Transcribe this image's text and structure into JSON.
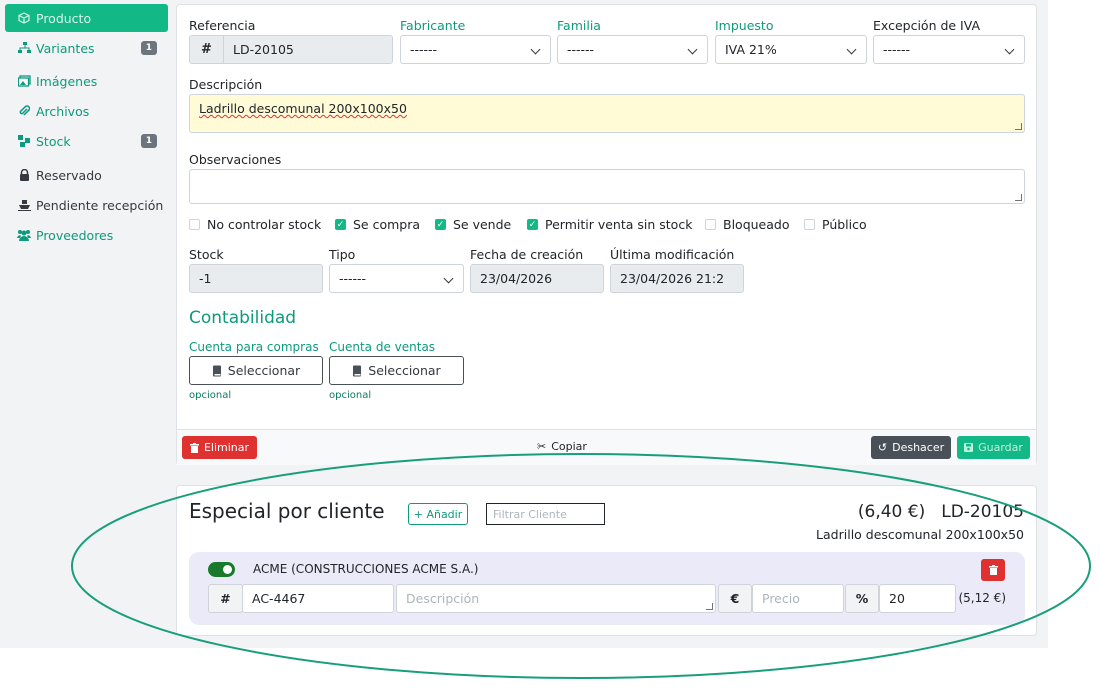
{
  "sidebar": {
    "items": [
      {
        "label": "Producto",
        "icon": "cube-icon",
        "active": true
      },
      {
        "label": "Variantes",
        "icon": "sitemap-icon",
        "badge": "1"
      },
      {
        "label": "Imágenes",
        "icon": "images-icon"
      },
      {
        "label": "Archivos",
        "icon": "paperclip-icon"
      },
      {
        "label": "Stock",
        "icon": "cubes-icon",
        "badge": "1"
      },
      {
        "label": "Reservado",
        "icon": "lock-icon"
      },
      {
        "label": "Pendiente recepción",
        "icon": "ship-icon"
      },
      {
        "label": "Proveedores",
        "icon": "users-icon"
      }
    ]
  },
  "form": {
    "referencia": {
      "label": "Referencia",
      "addon": "#",
      "value": "LD-20105"
    },
    "fabricante": {
      "label": "Fabricante",
      "value": "------"
    },
    "familia": {
      "label": "Familia",
      "value": "------"
    },
    "impuesto": {
      "label": "Impuesto",
      "value": "IVA 21%"
    },
    "excepcion": {
      "label": "Excepción de IVA",
      "value": "------"
    },
    "descripcion": {
      "label": "Descripción",
      "value": "Ladrillo descomunal 200x100x50"
    },
    "observaciones": {
      "label": "Observaciones",
      "value": ""
    },
    "checks": [
      {
        "label": "No controlar stock",
        "checked": false
      },
      {
        "label": "Se compra",
        "checked": true
      },
      {
        "label": "Se vende",
        "checked": true
      },
      {
        "label": "Permitir venta sin stock",
        "checked": true
      },
      {
        "label": "Bloqueado",
        "checked": false
      },
      {
        "label": "Público",
        "checked": false
      }
    ],
    "stock": {
      "label": "Stock",
      "value": "-1"
    },
    "tipo": {
      "label": "Tipo",
      "value": "------"
    },
    "fecha_creacion": {
      "label": "Fecha de creación",
      "value": "23/04/2026"
    },
    "ultima_mod": {
      "label": "Última modificación",
      "value": "23/04/2026 21:2"
    }
  },
  "contabilidad": {
    "title": "Contabilidad",
    "compras": {
      "label": "Cuenta para compras",
      "button": "Seleccionar",
      "hint": "opcional"
    },
    "ventas": {
      "label": "Cuenta de ventas",
      "button": "Seleccionar",
      "hint": "opcional"
    }
  },
  "footer": {
    "delete": "Eliminar",
    "copy": "Copiar",
    "undo": "Deshacer",
    "save": "Guardar"
  },
  "especial": {
    "title": "Especial por cliente",
    "add": "+ Añadir",
    "filter_placeholder": "Filtrar Cliente",
    "price": "(6,40 €)",
    "ref": "LD-20105",
    "desc": "Ladrillo descomunal 200x100x50",
    "client": {
      "enabled": true,
      "name": "ACME  (CONSTRUCCIONES ACME S.A.)",
      "hash": "#",
      "ref": "AC-4467",
      "desc_placeholder": "Descripción",
      "euro": "€",
      "price_placeholder": "Precio",
      "pct": "%",
      "discount": "20",
      "total": "(5,12 €)"
    }
  },
  "colors": {
    "accent": "#12b886",
    "teal_text": "#0d9a7d",
    "danger": "#e03131",
    "ellipse": "#199e7c"
  }
}
